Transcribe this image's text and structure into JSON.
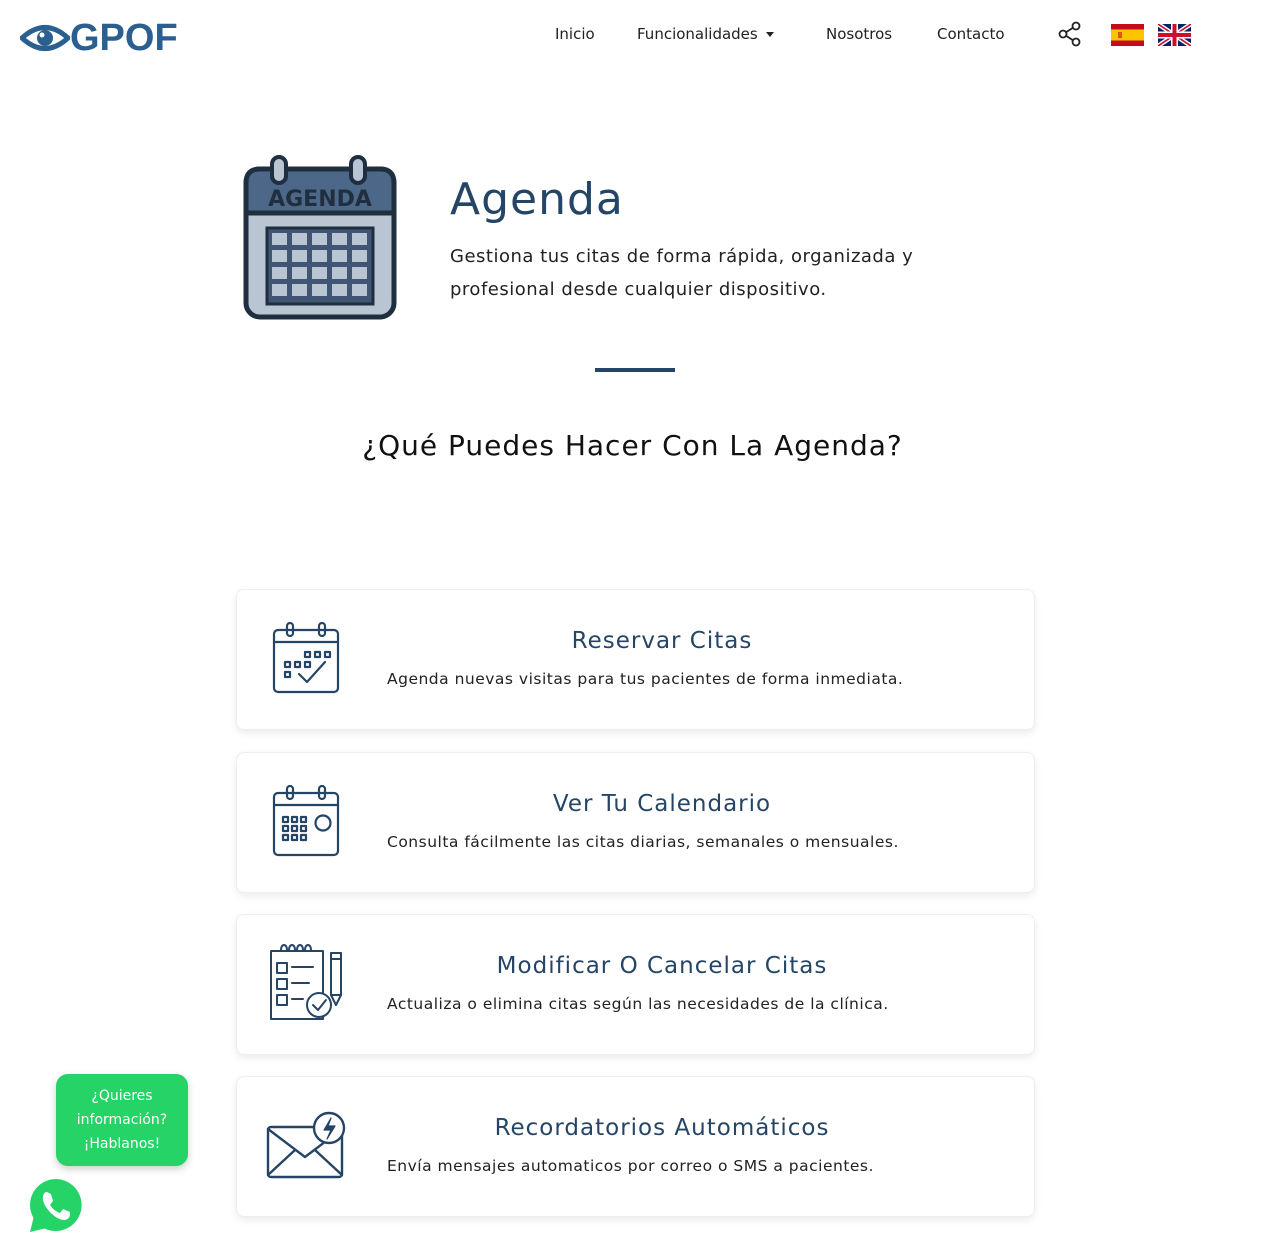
{
  "header": {
    "logo_text": "GPOF",
    "nav": {
      "inicio": "Inicio",
      "funcionalidades": "Funcionalidades",
      "nosotros": "Nosotros",
      "contacto": "Contacto"
    },
    "icons": [
      "eye-logo-icon",
      "share-icon",
      "flag-es-icon",
      "flag-uk-icon"
    ]
  },
  "hero": {
    "icon_label": "AGENDA",
    "title": "Agenda",
    "subtitle_line1": "Gestiona tus citas de forma rápida, organizada y",
    "subtitle_line2": "profesional desde cualquier dispositivo."
  },
  "section_title": "¿Qué Puedes Hacer Con La Agenda?",
  "features": [
    {
      "title": "Reservar Citas",
      "desc": "Agenda nuevas visitas para tus pacientes de forma inmediata.",
      "icon": "calendar-check-icon"
    },
    {
      "title": "Ver Tu Calendario",
      "desc": "Consulta fácilmente las citas diarias, semanales o mensuales.",
      "icon": "calendar-grid-icon"
    },
    {
      "title": "Modificar O Cancelar Citas",
      "desc": "Actualiza o elimina citas según las necesidades de la clínica.",
      "icon": "checklist-icon"
    },
    {
      "title": "Recordatorios Automáticos",
      "desc": "Envía mensajes automaticos por correo o SMS a pacientes.",
      "icon": "envelope-bolt-icon"
    }
  ],
  "chat": {
    "line1": "¿Quieres",
    "line2": "información?",
    "line3": "¡Hablanos!"
  },
  "colors": {
    "primary": "#254566",
    "logo": "#2a5f8f",
    "whatsapp": "#25d366"
  }
}
